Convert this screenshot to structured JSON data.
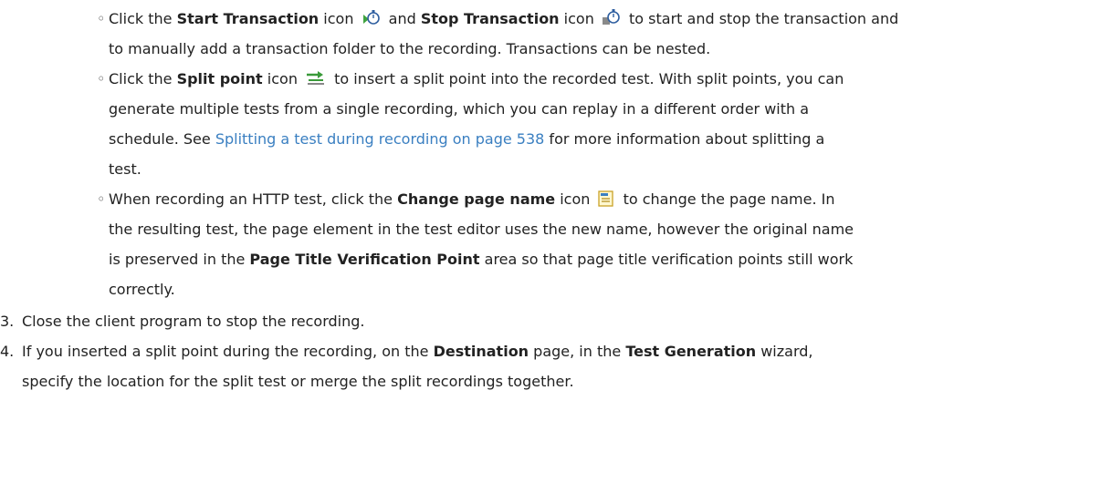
{
  "items": {
    "transaction": {
      "p1": "Click the ",
      "b1": "Start Transaction",
      "p2": " icon ",
      "icon1": "start-transaction-icon",
      "p3": " and ",
      "b2": "Stop Transaction",
      "p4": " icon ",
      "icon2": "stop-transaction-icon",
      "p5": " to start and stop the transaction and",
      "line2": "to manually add a transaction folder to the recording. Transactions can be nested."
    },
    "split": {
      "p1": "Click the ",
      "b1": "Split point",
      "p2": " icon ",
      "icon1": "split-point-icon",
      "p3": " to insert a split point into the recorded test. With split points, you can",
      "line2": "generate multiple tests from a single recording, which you can replay in a different order with a",
      "line3a": "schedule. See ",
      "link": "Splitting a test during recording on page 538",
      "line3b": " for more information about splitting a",
      "line4": "test."
    },
    "pagename": {
      "p1": "When recording an HTTP test, click the ",
      "b1": "Change page name",
      "p2": " icon ",
      "icon1": "change-page-name-icon",
      "p3": " to change the page name. In",
      "line2": "the resulting test, the page element in the test editor uses the new name, however the original name",
      "line3a": "is preserved in the ",
      "b2": "Page Title Verification Point",
      "line3b": " area so that page title verification points still work",
      "line4": "correctly."
    }
  },
  "steps": {
    "s3": {
      "num": "3.",
      "text": "Close the client program to stop the recording."
    },
    "s4": {
      "num": "4.",
      "p1": "If you inserted a split point during the recording, on the ",
      "b1": "Destination",
      "p2": " page, in the ",
      "b2": "Test Generation",
      "p3": " wizard,",
      "line2": "specify the location for the split test or merge the split recordings together."
    }
  },
  "colors": {
    "link": "#3a7fc1",
    "text": "#222222"
  }
}
